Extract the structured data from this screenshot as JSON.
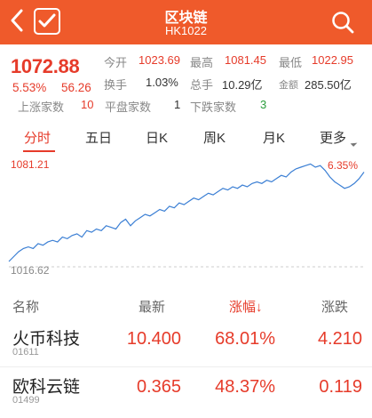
{
  "header": {
    "title": "区块链",
    "code": "HK1022",
    "bg_color": "#ef5a2b"
  },
  "quote": {
    "price": "1072.88",
    "change_pct": "5.53%",
    "change_amt": "56.26",
    "open_label": "今开",
    "open": "1023.69",
    "high_label": "最高",
    "high": "1081.45",
    "low_label": "最低",
    "low": "1022.95",
    "turnover_label": "换手",
    "turnover": "1.03%",
    "volume_label": "总手",
    "volume": "10.29亿",
    "amount_label": "金额",
    "amount": "285.50亿",
    "up_label": "上涨家数",
    "up": "10",
    "flat_label": "平盘家数",
    "flat": "1",
    "down_label": "下跌家数",
    "down": "3"
  },
  "tabs": [
    {
      "label": "分时",
      "active": true
    },
    {
      "label": "五日",
      "active": false
    },
    {
      "label": "日K",
      "active": false
    },
    {
      "label": "周K",
      "active": false
    },
    {
      "label": "月K",
      "active": false
    },
    {
      "label": "更多",
      "active": false
    }
  ],
  "chart_data": {
    "type": "line",
    "y_max_label": "1081.21",
    "y_min_label": "1016.62",
    "change_label": "6.35%",
    "ylim": [
      1016.62,
      1081.21
    ],
    "values": [
      1021,
      1024,
      1027,
      1029,
      1030,
      1029,
      1032,
      1031,
      1033,
      1034,
      1033,
      1036,
      1035,
      1037,
      1038,
      1036,
      1040,
      1039,
      1041,
      1040,
      1043,
      1042,
      1041,
      1045,
      1047,
      1043,
      1046,
      1048,
      1050,
      1049,
      1051,
      1053,
      1052,
      1055,
      1054,
      1057,
      1056,
      1058,
      1060,
      1059,
      1061,
      1063,
      1062,
      1064,
      1066,
      1065,
      1067,
      1066,
      1068,
      1067,
      1069,
      1070,
      1069,
      1071,
      1070,
      1072,
      1074,
      1073,
      1076,
      1078,
      1079,
      1080,
      1081,
      1079,
      1080,
      1077,
      1073,
      1070,
      1068,
      1066,
      1067,
      1069,
      1072,
      1076
    ],
    "line_color": "#3b7fd4"
  },
  "list": {
    "col_name": "名称",
    "col_latest": "最新",
    "col_change_pct": "涨幅",
    "col_change_amt": "涨跌",
    "sort_arrow": "↓",
    "rows": [
      {
        "name": "火币科技",
        "code": "01611",
        "latest": "10.400",
        "pct": "68.01%",
        "chg": "4.210"
      },
      {
        "name": "欧科云链",
        "code": "01499",
        "latest": "0.365",
        "pct": "48.37%",
        "chg": "0.119"
      }
    ]
  }
}
